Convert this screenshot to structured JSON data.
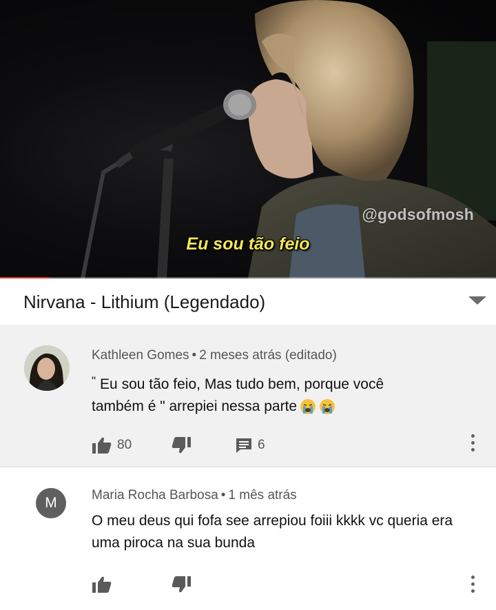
{
  "video": {
    "watermark": "@godsofmosh",
    "subtitle": "Eu sou tão feio",
    "progress": 0.1,
    "title": "Nirvana - Lithium (Legendado)"
  },
  "comments": [
    {
      "author": "Kathleen Gomes",
      "time": "2 meses atrás (editado)",
      "text_quote_open": "\"",
      "text": "Eu sou tão feio, Mas tudo bem, porque você também é \" arrepiei nessa parte",
      "text_line1": "Eu sou tão feio, Mas tudo bem, porque você",
      "text_line2": "também é \" arrepiei nessa parte",
      "emojis": [
        "crying-face",
        "crying-face"
      ],
      "likes": "80",
      "replies": "6"
    },
    {
      "author": "Maria Rocha Barbosa",
      "avatar_letter": "M",
      "time": "1 mês atrás",
      "text": "O meu deus qui fofa see arrepiou foiii kkkk vc queria era uma piroca na sua bunda"
    }
  ],
  "separator": "•",
  "colors": {
    "subtitle": "#f2e75a",
    "progress": "#e5332a",
    "comment_bg_highlight": "#f1f1f1",
    "avatar_letter_bg": "#5f5f5f"
  }
}
